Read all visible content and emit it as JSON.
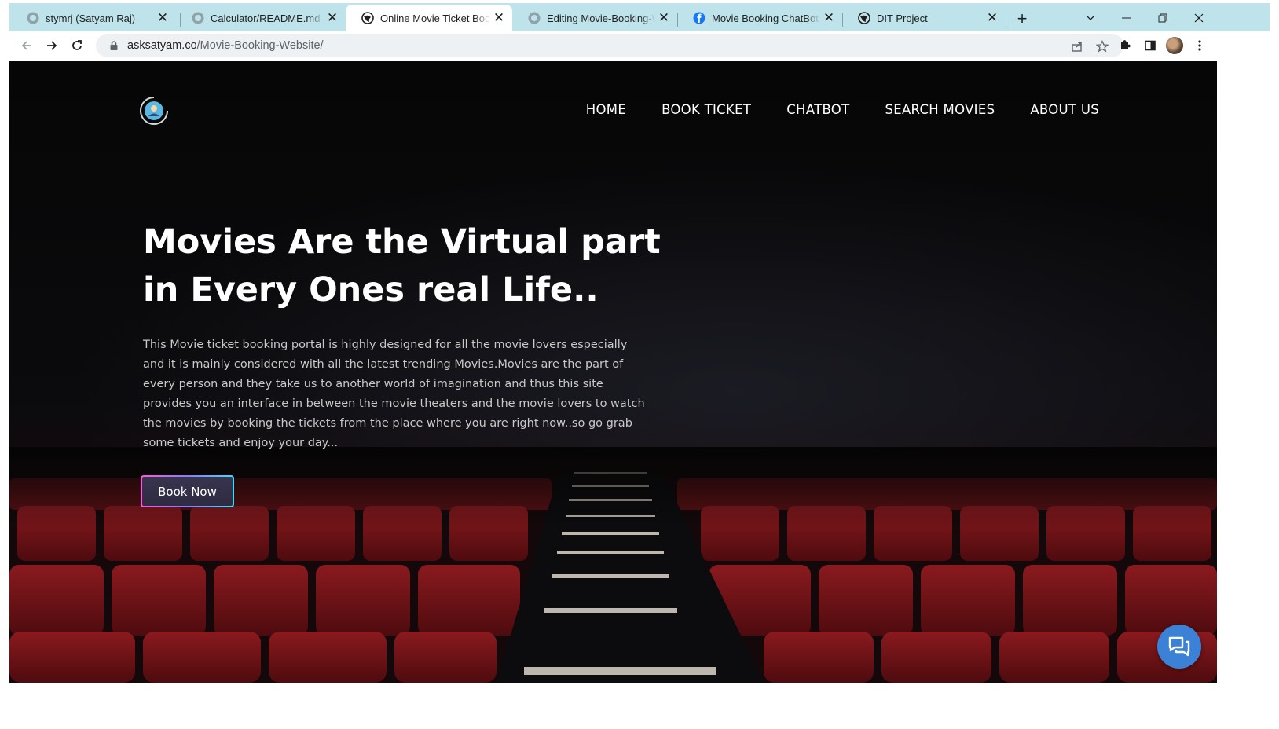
{
  "browser": {
    "tabs": [
      {
        "title": "stymrj (Satyam Raj)",
        "icon": "github-icon",
        "active": false
      },
      {
        "title": "Calculator/README.md at main",
        "icon": "github-icon",
        "active": false
      },
      {
        "title": "Online Movie Ticket Booking",
        "icon": "globe-icon",
        "active": true
      },
      {
        "title": "Editing Movie-Booking-Website",
        "icon": "github-icon",
        "active": false
      },
      {
        "title": "Movie Booking ChatBot | DIT",
        "icon": "facebook-icon",
        "active": false
      },
      {
        "title": "DIT Project",
        "icon": "globe-icon",
        "active": false
      }
    ],
    "url_host": "asksatyam.co",
    "url_path": "/Movie-Booking-Website/"
  },
  "site": {
    "nav": [
      "HOME",
      "BOOK TICKET",
      "CHATBOT",
      "SEARCH MOVIES",
      "ABOUT US"
    ],
    "hero_title": "Movies Are the Virtual part in Every Ones real Life..",
    "hero_text": "This Movie ticket booking portal is highly designed for all the movie lovers especially and it is mainly considered with all the latest trending Movies.Movies are the part of every person and they take us to another world of imagination and thus this site provides you an interface in between the movie theaters and the movie lovers to watch the movies by booking the tickets from the place where you are right now..so go grab some tickets and enjoy your day...",
    "cta_label": "Book Now"
  },
  "colors": {
    "tabstrip": "#bfe3ea",
    "seat_red": "#7a1418",
    "chat_fab": "#3b82d6"
  }
}
